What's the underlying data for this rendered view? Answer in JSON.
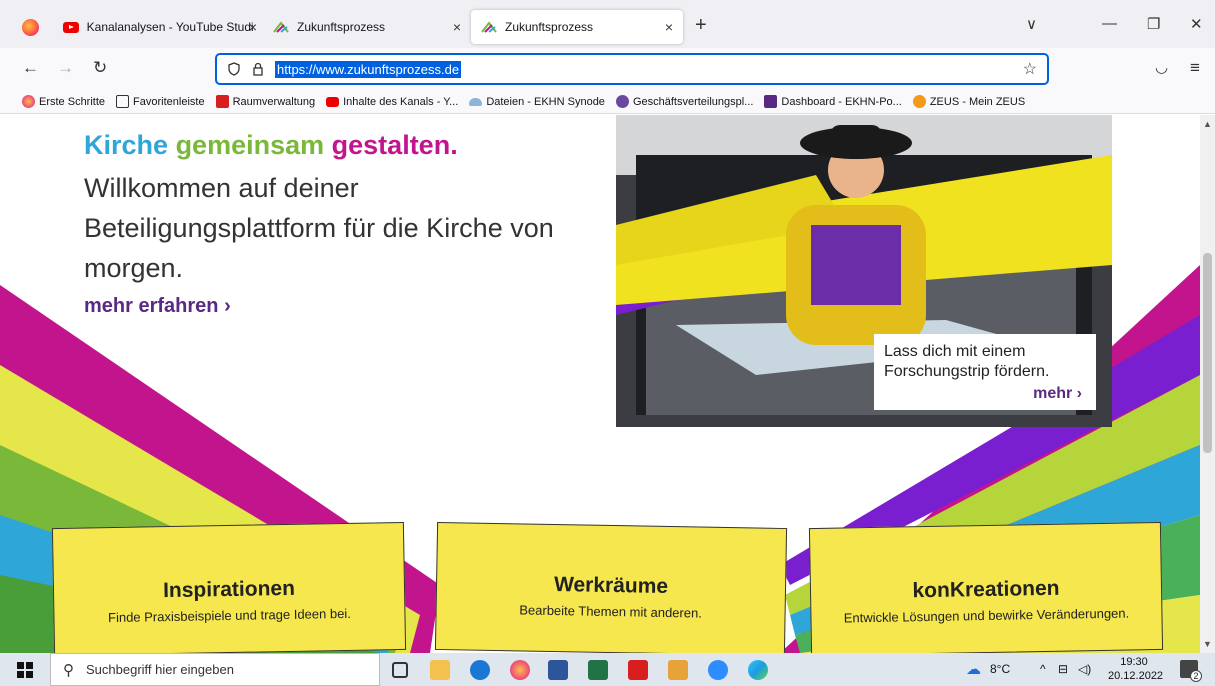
{
  "tabs": [
    {
      "title": "Kanalanalysen - YouTube Studio",
      "close": "×"
    },
    {
      "title": "Zukunftsprozess",
      "close": "×"
    },
    {
      "title": "Zukunftsprozess",
      "close": "×"
    }
  ],
  "new_tab": "+",
  "window": {
    "list_all": "∨",
    "minimize": "—",
    "restore": "❐",
    "close": "✕"
  },
  "nav": {
    "back": "←",
    "forward": "→",
    "reload": "↻",
    "url": "https://www.zukunftsprozess.de",
    "star": "☆",
    "pocket": "◡",
    "menu": "≡"
  },
  "bookmarks": [
    {
      "label": "Erste Schritte",
      "color": "#ff7139"
    },
    {
      "label": "Favoritenleiste",
      "color": "#ffffff"
    },
    {
      "label": "Raumverwaltung",
      "color": "#d81f1f"
    },
    {
      "label": "Inhalte des Kanals - Y...",
      "color": "#e00000"
    },
    {
      "label": "Dateien - EKHN Synode",
      "color": "#8fb4d9"
    },
    {
      "label": "Geschäftsverteilungspl...",
      "color": "#6a4aa0"
    },
    {
      "label": "Dashboard - EKHN-Po...",
      "color": "#5a2a82"
    },
    {
      "label": "ZEUS - Mein ZEUS",
      "color": "#f19a1c"
    }
  ],
  "page": {
    "headline": {
      "word1": "Kirche",
      "word2": "gemeinsam",
      "word3": "gestalten."
    },
    "intro": "Willkommen auf deiner Beteiligungsplattform für die Kirche von morgen.",
    "more_link": "mehr erfahren",
    "hero_caption": {
      "line1": "Lass dich mit einem",
      "line2": "Forschungstrip fördern.",
      "more": "mehr"
    },
    "cards": [
      {
        "title": "Inspirationen",
        "text": "Finde Praxisbeispiele und trage Ideen bei."
      },
      {
        "title": "Werkräume",
        "text": "Bearbeite Themen mit anderen."
      },
      {
        "title": "konKreationen",
        "text": "Entwickle Lösungen und bewirke Veränderungen."
      }
    ]
  },
  "colors": {
    "cyan": "#2ea7d8",
    "green": "#7ab83a",
    "magenta": "#c2148c",
    "purple": "#5a2a82",
    "yellow": "#f5e74d"
  },
  "taskbar": {
    "search_placeholder": "Suchbegriff hier eingeben",
    "weather": "8°C",
    "time": "19:30",
    "date": "20.12.2022",
    "notifications": "2"
  }
}
